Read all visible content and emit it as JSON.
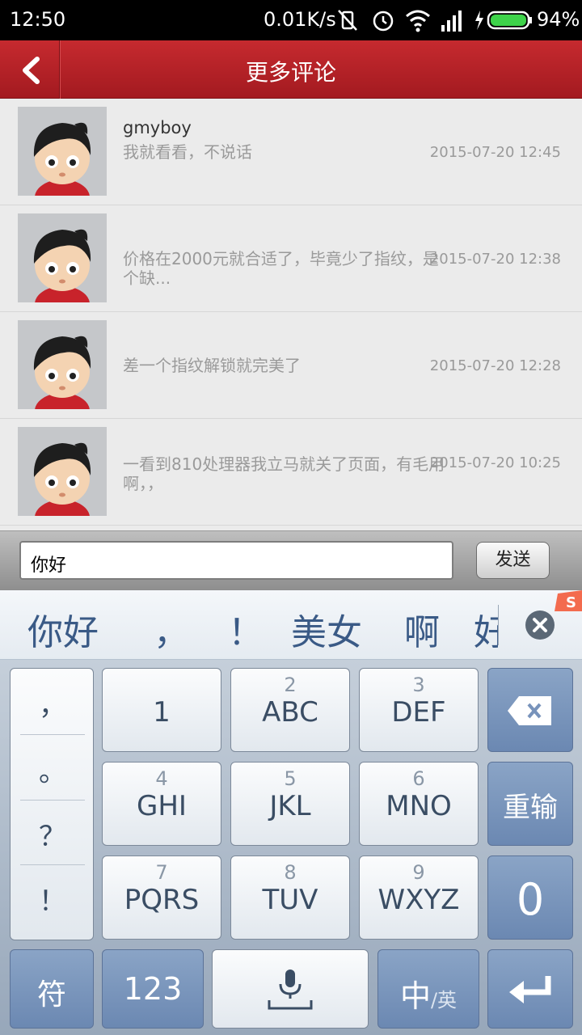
{
  "status_bar": {
    "time": "12:50",
    "net_speed": "0.01K/s",
    "battery": "94%"
  },
  "header": {
    "title": "更多评论"
  },
  "comments": [
    {
      "user": "gmyboy",
      "text": "我就看看，不说话",
      "time": "2015-07-20 12:45"
    },
    {
      "user": "",
      "text": "价格在2000元就合适了，毕竟少了指纹，是个缺...",
      "time": "2015-07-20 12:38"
    },
    {
      "user": "",
      "text": "差一个指纹解锁就完美了",
      "time": "2015-07-20 12:28"
    },
    {
      "user": "",
      "text": "一看到810处理器我立马就关了页面，有毛用啊，，",
      "time": "2015-07-20 10:25"
    }
  ],
  "input": {
    "value": "你好",
    "send_label": "发送"
  },
  "candidates": [
    "你好",
    "，",
    "！",
    "美女",
    "啊",
    "好"
  ],
  "keyboard": {
    "punct": [
      "，",
      "。",
      "？",
      "！"
    ],
    "keys": [
      {
        "num": "",
        "label": "1"
      },
      {
        "num": "2",
        "label": "ABC"
      },
      {
        "num": "3",
        "label": "DEF"
      },
      {
        "num": "4",
        "label": "GHI"
      },
      {
        "num": "5",
        "label": "JKL"
      },
      {
        "num": "6",
        "label": "MNO"
      },
      {
        "num": "7",
        "label": "PQRS"
      },
      {
        "num": "8",
        "label": "TUV"
      },
      {
        "num": "9",
        "label": "WXYZ"
      }
    ],
    "reinput": "重输",
    "zero": "0",
    "symbol": "符",
    "numeric": "123",
    "lang_main": "中",
    "lang_alt": "/英"
  },
  "colors": {
    "header": "#b0222a",
    "key_blue": "#7893bb",
    "candidate_text": "#3a5a86"
  }
}
